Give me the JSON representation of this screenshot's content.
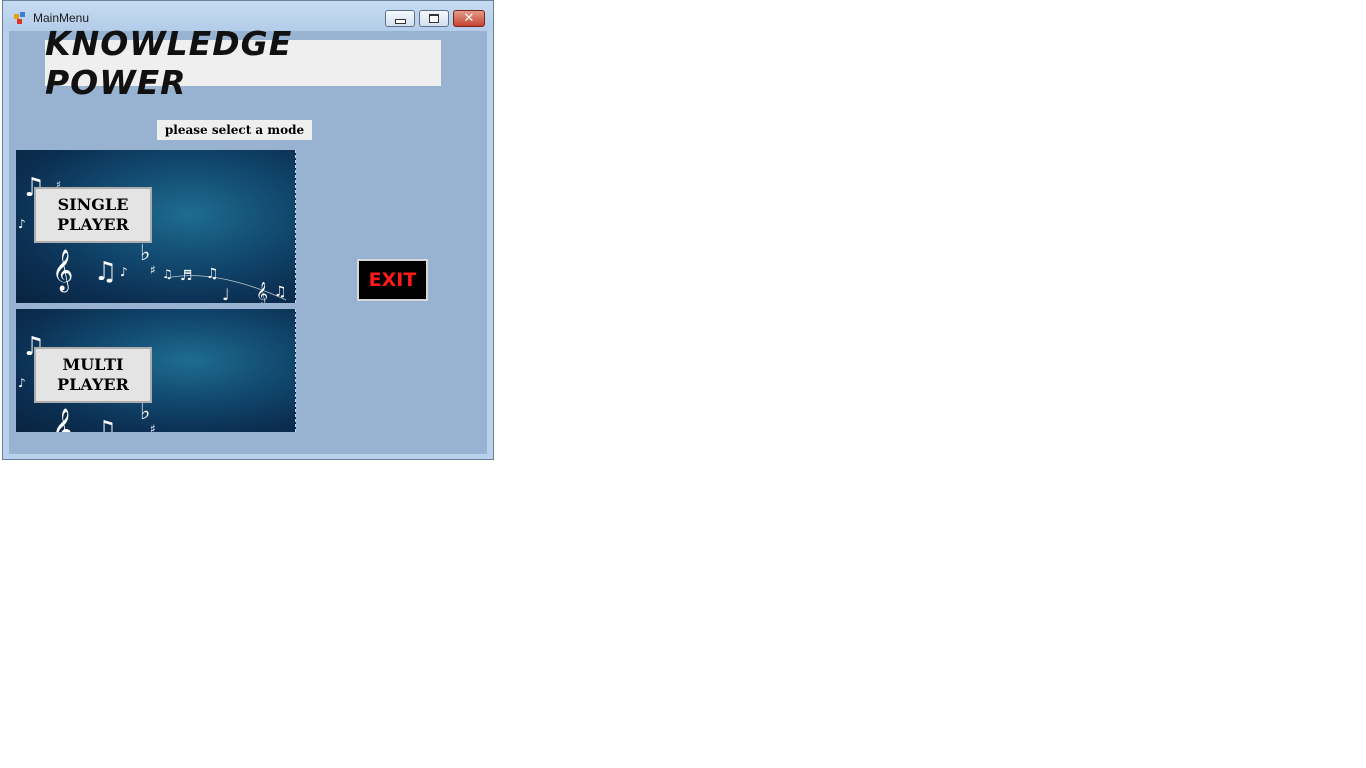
{
  "window": {
    "title": "MainMenu",
    "controls": {
      "minimize": "minimize",
      "maximize": "maximize",
      "close": "✕"
    }
  },
  "header": {
    "banner": "KNOWLEDGE POWER"
  },
  "prompt": "please select a mode",
  "modes": {
    "single": {
      "line1": "SINGLE",
      "line2": "PLAYER"
    },
    "multi": {
      "line1": "MULTI",
      "line2": "PLAYER"
    }
  },
  "exit_label": "EXIT",
  "icons": {
    "app": "app-icon",
    "minimize": "minimize-icon",
    "maximize": "maximize-icon",
    "close": "close-icon",
    "music_notes": "music-notes-icon"
  },
  "colors": {
    "client_bg": "#98b3d2",
    "exit_text": "#ff1a1a",
    "panel_bg": "#0b2f52"
  }
}
